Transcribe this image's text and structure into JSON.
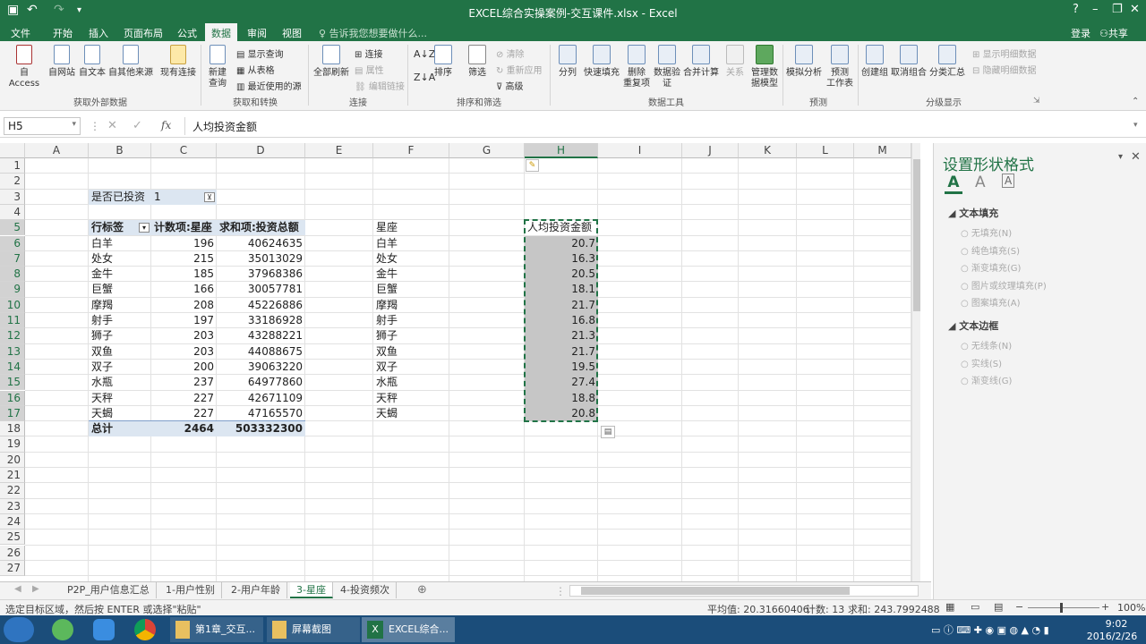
{
  "window": {
    "title": "EXCEL综合实操案例-交互课件.xlsx - Excel",
    "controls": [
      "?",
      "–",
      "❐",
      "✕"
    ]
  },
  "ribbon_tabs": [
    "文件",
    "开始",
    "插入",
    "页面布局",
    "公式",
    "数据",
    "审阅",
    "视图"
  ],
  "tell_me": "告诉我您想要做什么...",
  "account": {
    "login": "登录",
    "share": "共享"
  },
  "ribbon": {
    "buttons": [
      {
        "label": "自 Access"
      },
      {
        "label": "自网站"
      },
      {
        "label": "自文本"
      },
      {
        "label": "自其他来源"
      },
      {
        "label": "现有连接"
      },
      {
        "label": "新建\n查询"
      },
      {
        "label": "全部刷新"
      },
      {
        "label": "排序"
      },
      {
        "label": "筛选"
      },
      {
        "label": "分列"
      },
      {
        "label": "快速填充"
      },
      {
        "label": "删除\n重复项"
      },
      {
        "label": "数据验\n证"
      },
      {
        "label": "合并计算"
      },
      {
        "label": "关系"
      },
      {
        "label": "管理数\n据模型"
      },
      {
        "label": "模拟分析"
      },
      {
        "label": "预测\n工作表"
      },
      {
        "label": "创建组"
      },
      {
        "label": "取消组合"
      },
      {
        "label": "分类汇总"
      }
    ],
    "small_items": {
      "show_query": "显示查询",
      "from_table": "从表格",
      "recent_sources": "最近使用的源",
      "connections": "连接",
      "properties": "属性",
      "edit_links": "编辑链接",
      "clear": "清除",
      "reapply": "重新应用",
      "advanced": "高级",
      "show_detail": "显示明细数据",
      "hide_detail": "隐藏明细数据"
    },
    "groups": [
      "获取外部数据",
      "获取和转换",
      "连接",
      "排序和筛选",
      "数据工具",
      "预测",
      "分级显示"
    ]
  },
  "formula_bar": {
    "name_box": "H5",
    "fx": "fx",
    "formula": "人均投资金额"
  },
  "columns": [
    "A",
    "B",
    "C",
    "D",
    "E",
    "F",
    "G",
    "H",
    "I",
    "J",
    "K",
    "L",
    "M"
  ],
  "rows": [
    "1",
    "2",
    "3",
    "4",
    "5",
    "6",
    "7",
    "8",
    "9",
    "10",
    "11",
    "12",
    "13",
    "14",
    "15",
    "16",
    "17",
    "18",
    "19",
    "20",
    "21",
    "22",
    "23",
    "24",
    "25",
    "26",
    "27"
  ],
  "pivot": {
    "filter_label": "是否已投资",
    "filter_value": "1",
    "headers": [
      "行标签",
      "计数项:星座",
      "求和项:投资总额"
    ],
    "rows": [
      [
        "白羊",
        "196",
        "40624635"
      ],
      [
        "处女",
        "215",
        "35013029"
      ],
      [
        "金牛",
        "185",
        "37968386"
      ],
      [
        "巨蟹",
        "166",
        "30057781"
      ],
      [
        "摩羯",
        "208",
        "45226886"
      ],
      [
        "射手",
        "197",
        "33186928"
      ],
      [
        "狮子",
        "203",
        "43288221"
      ],
      [
        "双鱼",
        "203",
        "44088675"
      ],
      [
        "双子",
        "200",
        "39063220"
      ],
      [
        "水瓶",
        "237",
        "64977860"
      ],
      [
        "天秤",
        "227",
        "42671109"
      ],
      [
        "天蝎",
        "227",
        "47165570"
      ]
    ],
    "total": [
      "总计",
      "2464",
      "503332300"
    ]
  },
  "side_table": {
    "header_f": "星座",
    "header_h": "人均投资金额",
    "signs": [
      "白羊",
      "处女",
      "金牛",
      "巨蟹",
      "摩羯",
      "射手",
      "狮子",
      "双鱼",
      "双子",
      "水瓶",
      "天秤",
      "天蝎"
    ],
    "values": [
      "20.7",
      "16.3",
      "20.5",
      "18.1",
      "21.7",
      "16.8",
      "21.3",
      "21.7",
      "19.5",
      "27.4",
      "18.8",
      "20.8"
    ]
  },
  "format_pane": {
    "title": "设置形状格式",
    "fill_section": "文本填充",
    "fill_options": [
      "无填充(N)",
      "纯色填充(S)",
      "渐变填充(G)",
      "图片或纹理填充(P)",
      "图案填充(A)"
    ],
    "border_section": "文本边框",
    "border_options": [
      "无线条(N)",
      "实线(S)",
      "渐变线(G)"
    ]
  },
  "sheets": [
    "P2P_用户信息汇总",
    "1-用户性别",
    "2-用户年龄",
    "3-星座",
    "4-投资频次"
  ],
  "active_sheet": "3-星座",
  "status": {
    "message": "选定目标区域，然后按 ENTER 或选择\"粘贴\"",
    "average": "平均值: 20.31660406",
    "count": "计数: 13",
    "sum": "求和: 243.7992488",
    "zoom": "100%"
  },
  "taskbar": {
    "items": [
      "第1章_交互...",
      "屏幕截图",
      "EXCEL综合..."
    ],
    "time": "9:02",
    "date": "2016/2/26"
  },
  "colors": {
    "excel_green": "#217346",
    "selection_fill": "#c6c6c6",
    "pivot_header": "#dce6f1"
  }
}
